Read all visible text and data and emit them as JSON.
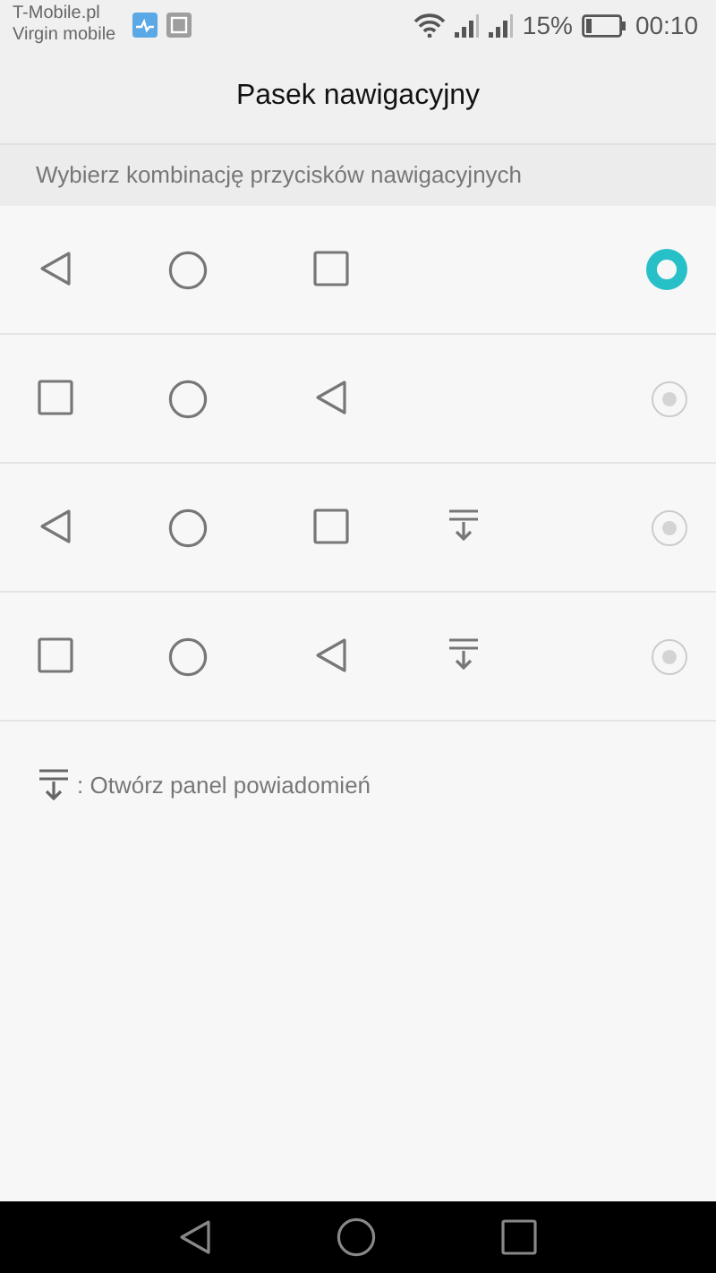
{
  "status_bar": {
    "carriers": [
      "T-Mobile.pl",
      "Virgin mobile"
    ],
    "battery_text": "15%",
    "time": "00:10"
  },
  "title": "Pasek nawigacyjny",
  "section_header": "Wybierz kombinację przycisków nawigacyjnych",
  "options": [
    {
      "selected": true,
      "buttons": [
        {
          "kind": "back"
        },
        {
          "kind": "home"
        },
        {
          "kind": "recent"
        }
      ]
    },
    {
      "selected": false,
      "buttons": [
        {
          "kind": "recent"
        },
        {
          "kind": "home"
        },
        {
          "kind": "back"
        }
      ]
    },
    {
      "selected": false,
      "buttons": [
        {
          "kind": "back"
        },
        {
          "kind": "home"
        },
        {
          "kind": "recent"
        },
        {
          "kind": "notification"
        }
      ]
    },
    {
      "selected": false,
      "buttons": [
        {
          "kind": "recent"
        },
        {
          "kind": "home"
        },
        {
          "kind": "back"
        },
        {
          "kind": "notification"
        }
      ]
    }
  ],
  "legend": ": Otwórz panel powiadomień",
  "nav_bar": {
    "buttons": [
      {
        "kind": "back"
      },
      {
        "kind": "home"
      },
      {
        "kind": "recent"
      }
    ]
  }
}
